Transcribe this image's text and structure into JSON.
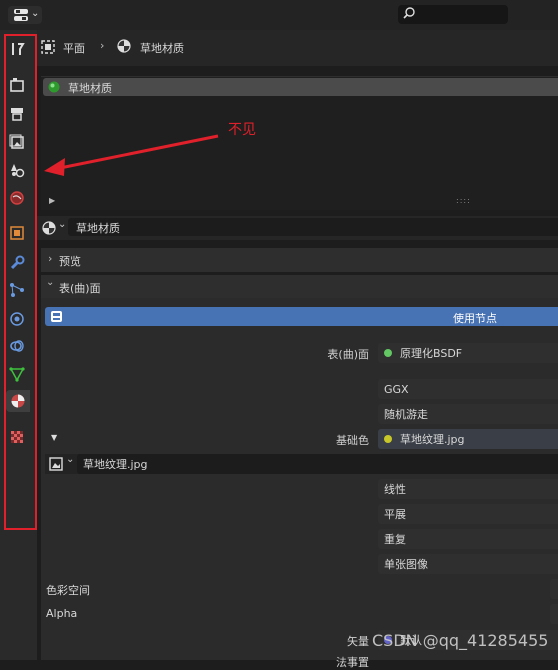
{
  "header": {
    "search_placeholder": ""
  },
  "breadcrumb": {
    "object": "平面",
    "material": "草地材质"
  },
  "slots": {
    "items": [
      {
        "label": "草地材质"
      }
    ]
  },
  "datablock": {
    "material_name": "草地材质"
  },
  "panels": {
    "preview": "预览",
    "surface": "表(曲)面"
  },
  "surface": {
    "use_nodes_label": "使用节点",
    "surface_label": "表(曲)面",
    "surface_value": "原理化BSDF",
    "distribution": "GGX",
    "subsurface_method": "随机游走",
    "base_color_label": "基础色",
    "base_color_value": "草地纹理.jpg",
    "image_name": "草地纹理.jpg",
    "interpolation": "线性",
    "projection": "平展",
    "extension": "重复",
    "source": "单张图像",
    "color_space_label": "色彩空间",
    "alpha_label": "Alpha",
    "vector_label": "矢量",
    "vector_value": "默认",
    "partial_next_label": "法事置"
  },
  "annotation": {
    "text": "不见",
    "color": "#e0202a"
  },
  "watermark": "CSDN @qq_41285455",
  "colors": {
    "accent_blue": "#4772b3",
    "highlight_red": "#e0202a",
    "socket_green": "#63c763",
    "socket_yellow": "#c7c729",
    "socket_purple": "#6363c7"
  }
}
